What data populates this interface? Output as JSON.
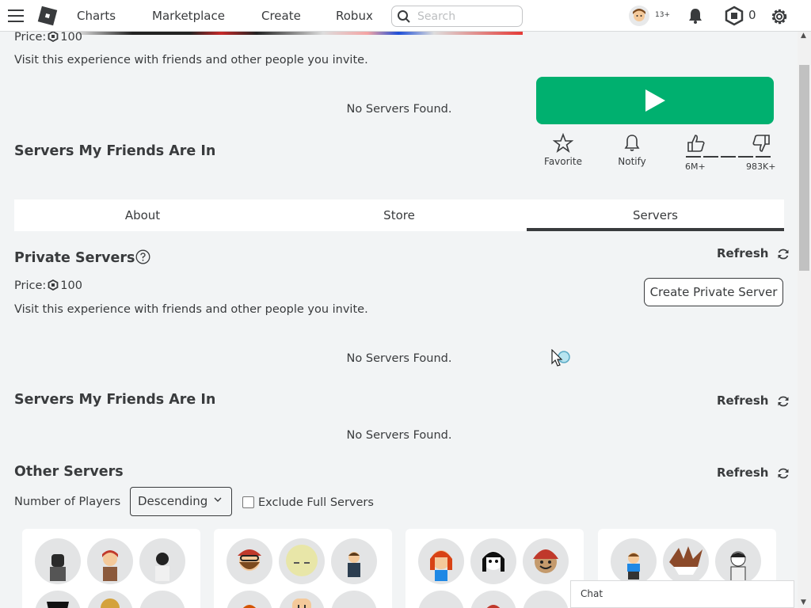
{
  "nav": {
    "links": [
      "Charts",
      "Marketplace",
      "Create",
      "Robux"
    ],
    "search_placeholder": "Search",
    "age_badge": "13+",
    "robux_balance": "0"
  },
  "top": {
    "price_label": "Price:",
    "price_value": "100",
    "invite_text": "Visit this experience with friends and other people you invite.",
    "no_servers": "No Servers Found.",
    "friends_heading": "Servers My Friends Are In"
  },
  "actions": {
    "favorite": "Favorite",
    "notify": "Notify",
    "upvotes": "6M+",
    "downvotes": "983K+"
  },
  "tabs": [
    {
      "label": "About",
      "active": false
    },
    {
      "label": "Store",
      "active": false
    },
    {
      "label": "Servers",
      "active": true
    }
  ],
  "private_servers": {
    "heading": "Private Servers",
    "refresh": "Refresh",
    "price_label": "Price:",
    "price_value": "100",
    "invite_text": "Visit this experience with friends and other people you invite.",
    "create_button": "Create Private Server",
    "no_servers": "No Servers Found."
  },
  "friends_servers": {
    "heading": "Servers My Friends Are In",
    "refresh": "Refresh",
    "no_servers": "No Servers Found."
  },
  "other_servers": {
    "heading": "Other Servers",
    "refresh": "Refresh",
    "sort_label": "Number of Players",
    "sort_value": "Descending",
    "exclude_label": "Exclude Full Servers"
  },
  "chat": {
    "label": "Chat"
  },
  "colors": {
    "play_green": "#00b06f",
    "text": "#393b3d",
    "background": "#f2f4f5"
  }
}
